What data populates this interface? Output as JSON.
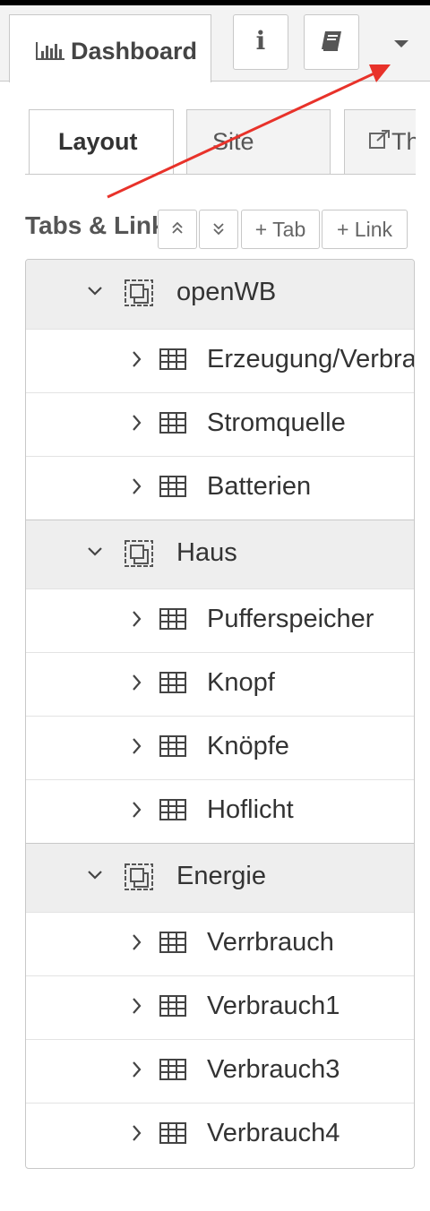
{
  "header": {
    "dashboard_tab_label": "Dashboard",
    "info_button_glyph": "i",
    "book_button_glyph": "▮"
  },
  "subtabs": [
    {
      "label": "Layout",
      "active": true
    },
    {
      "label": "Site",
      "active": false
    },
    {
      "label": "Theme",
      "active": false
    }
  ],
  "section": {
    "title": "Tabs & Links",
    "buttons": {
      "collapse": "«",
      "expand": "»",
      "add_tab": "+ Tab",
      "add_link": "+ Link"
    }
  },
  "tree": {
    "tabs": [
      {
        "name": "openWB",
        "groups": [
          "Erzeugung/Verbrauch",
          "Stromquelle",
          "Batterien"
        ]
      },
      {
        "name": "Haus",
        "groups": [
          "Pufferspeicher",
          "Knopf",
          "Knöpfe",
          "Hoflicht"
        ]
      },
      {
        "name": "Energie",
        "groups": [
          "Verrbrauch",
          "Verbrauch1",
          "Verbrauch3",
          "Verbrauch4"
        ]
      }
    ]
  },
  "colors": {
    "annotation_arrow": "#e8322a",
    "tab_row_bg": "#eeeeee",
    "border": "#c8c8c8"
  }
}
